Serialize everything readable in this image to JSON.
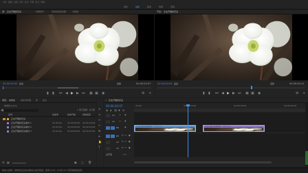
{
  "app_bar": {
    "title": "文件  编辑  剪辑  序列  标记  字幕  窗口  帮助",
    "tabs": [
      "组件",
      "编辑",
      "颜色",
      "效果",
      "音频"
    ]
  },
  "source_monitor": {
    "tabs": [
      "源： 正在开展的花朵",
      "效果控件",
      "音频剪辑混合器",
      "元数据"
    ],
    "timecode_in": "00:00:00:00",
    "fit": "适合",
    "timecode_out": "00:00:20:07",
    "quality": "完整"
  },
  "program_monitor": {
    "tab": "节目： 正在开展的花朵",
    "timecode_in": "00:00:00:00",
    "fit": "适合",
    "timecode_out": "00:00:40:12",
    "quality": "完整"
  },
  "project_panel": {
    "tabs": [
      "项目： 未命名",
      "媒体浏览器",
      "库",
      "信息"
    ],
    "path": "未命名.prproj",
    "count": "1 项已选择，共4项",
    "columns": [
      "名称",
      "帧速率",
      "媒体开始",
      "媒体结束"
    ],
    "items": [
      {
        "name": "正在开展的花朵",
        "fps": "",
        "start": "",
        "end": "",
        "color": "#e0a030"
      },
      {
        "name": "正在开展的花朵素材 1",
        "fps": "25.00 fps",
        "start": "00:00:00:00",
        "end": "00:00:20:06",
        "color": "#9a7ad0"
      },
      {
        "name": "正在开展的花朵素材 2",
        "fps": "25.00 fps",
        "start": "00:00:00:00",
        "end": "00:00:20:06",
        "color": "#9a7ad0"
      },
      {
        "name": "正在开展的花朵素材 3",
        "fps": "25.00 fps",
        "start": "00:00:00:00",
        "end": "00:00:20:06",
        "color": "#9a7ad0"
      }
    ]
  },
  "timeline": {
    "tab": "正在开展的花朵",
    "timecode": "00:00:20:07",
    "ruler": [
      "00:00",
      "00:00:15:00",
      "00:00:30:00",
      "00:00:45:00"
    ],
    "video_tracks": [
      "V3",
      "V2",
      "V1"
    ],
    "audio_tracks": [
      "A1",
      "A2",
      "A3"
    ],
    "master": "主声道",
    "master_value": "0.0",
    "clip1": "正在开展的花朵素材 1.mp4 [V]",
    "clip2": "正在开展的花朵素材 2.mp4 [V]"
  },
  "status_bar": {
    "text": "单击以选择，或单击空白处并拖动以进行框选。使用 Shift、Alt 和 Ctrl 可获得其他选项。"
  },
  "colors": {
    "accent": "#3d8ee8",
    "clip_video": "#5c8fc8",
    "clip_selected": "#8a74c0",
    "bg": "#1e1e1e"
  }
}
